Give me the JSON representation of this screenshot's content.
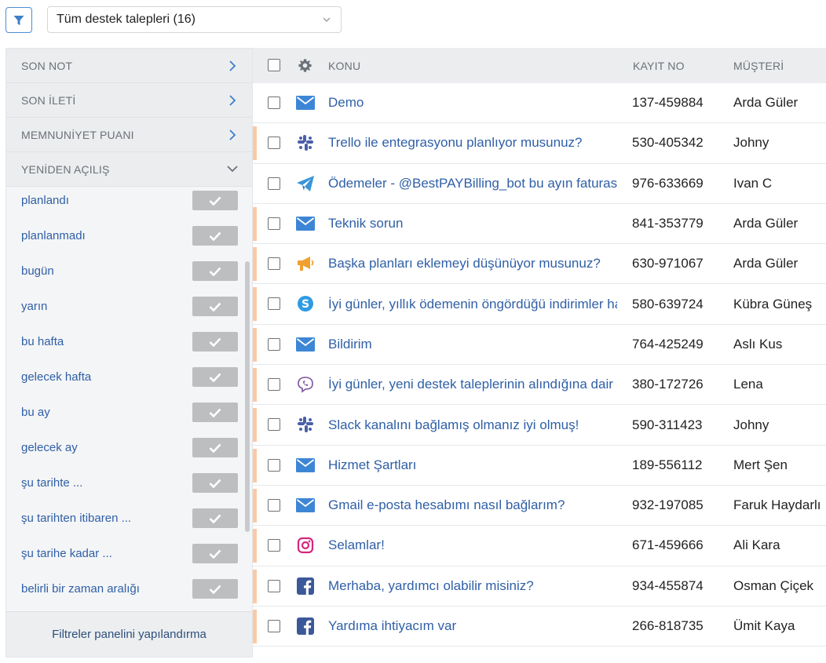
{
  "toolbar": {
    "view_select_value": "Tüm destek talepleri (16)"
  },
  "filters_panel": {
    "sections": [
      {
        "label": "SON NOT",
        "state": "collapsed"
      },
      {
        "label": "SON İLETİ",
        "state": "collapsed"
      },
      {
        "label": "MEMNUNİYET PUANI",
        "state": "collapsed"
      },
      {
        "label": "YENİDEN AÇILIŞ",
        "state": "expanded"
      }
    ],
    "options": [
      "planlandı",
      "planlanmadı",
      "bugün",
      "yarın",
      "bu hafta",
      "gelecek hafta",
      "bu ay",
      "gelecek ay",
      "şu tarihte ...",
      "şu tarihten itibaren ...",
      "şu tarihe kadar ...",
      "belirli bir zaman aralığı"
    ],
    "footer_label": "Filtreler panelini yapılandırma"
  },
  "table": {
    "headers": {
      "subject": "KONU",
      "record_no": "KAYIT NO",
      "customer": "MÜŞTERİ"
    },
    "rows": [
      {
        "channel": "email-icon",
        "subject": "Demo",
        "record_no": "137-459884",
        "customer": "Arda Güler",
        "marked": false
      },
      {
        "channel": "slack-icon",
        "subject": "Trello ile entegrasyonu planlıyor musunuz?",
        "record_no": "530-405342",
        "customer": "Johny",
        "marked": true
      },
      {
        "channel": "telegram-icon",
        "subject": "Ödemeler - @BestPAYBilling_bot bu ayın faturası",
        "record_no": "976-633669",
        "customer": "Ivan C",
        "marked": false
      },
      {
        "channel": "email-icon",
        "subject": "Teknik sorun",
        "record_no": "841-353779",
        "customer": "Arda Güler",
        "marked": true
      },
      {
        "channel": "megaphone-icon",
        "subject": "Başka planları eklemeyi düşünüyor musunuz?",
        "record_no": "630-971067",
        "customer": "Arda Güler",
        "marked": true
      },
      {
        "channel": "skype-icon",
        "subject": "İyi günler, yıllık ödemenin öngördüğü indirimler hakkında",
        "record_no": "580-639724",
        "customer": "Kübra Güneş",
        "marked": true
      },
      {
        "channel": "email-icon",
        "subject": "Bildirim",
        "record_no": "764-425249",
        "customer": "Aslı Kus",
        "marked": true
      },
      {
        "channel": "viber-icon",
        "subject": "İyi günler, yeni destek taleplerinin alındığına dair",
        "record_no": "380-172726",
        "customer": "Lena",
        "marked": true
      },
      {
        "channel": "slack-icon",
        "subject": "Slack kanalını bağlamış olmanız iyi olmuş!",
        "record_no": "590-311423",
        "customer": "Johny",
        "marked": true
      },
      {
        "channel": "email-icon",
        "subject": "Hizmet Şartları",
        "record_no": "189-556112",
        "customer": "Mert Şen",
        "marked": true
      },
      {
        "channel": "email-icon",
        "subject": "Gmail e-posta hesabımı nasıl bağlarım?",
        "record_no": "932-197085",
        "customer": "Faruk Haydarlı",
        "marked": true
      },
      {
        "channel": "instagram-icon",
        "subject": "Selamlar!",
        "record_no": "671-459666",
        "customer": "Ali Kara",
        "marked": true
      },
      {
        "channel": "facebook-icon",
        "subject": "Merhaba, yardımcı olabilir misiniz?",
        "record_no": "934-455874",
        "customer": "Osman Çiçek",
        "marked": true
      },
      {
        "channel": "facebook-icon",
        "subject": "Yardıma ihtiyacım var",
        "record_no": "266-818735",
        "customer": "Ümit Kaya",
        "marked": true
      }
    ]
  },
  "colors": {
    "link": "#2f5fa7",
    "email": "#3d86d6",
    "slack": "#4a5fa8",
    "telegram": "#3b95d9",
    "megaphone": "#f0a030",
    "skype": "#2f9be3",
    "viber": "#7b519d",
    "instagram": "#d6267e",
    "facebook": "#3b5998",
    "mark": "#f9c9a6"
  }
}
